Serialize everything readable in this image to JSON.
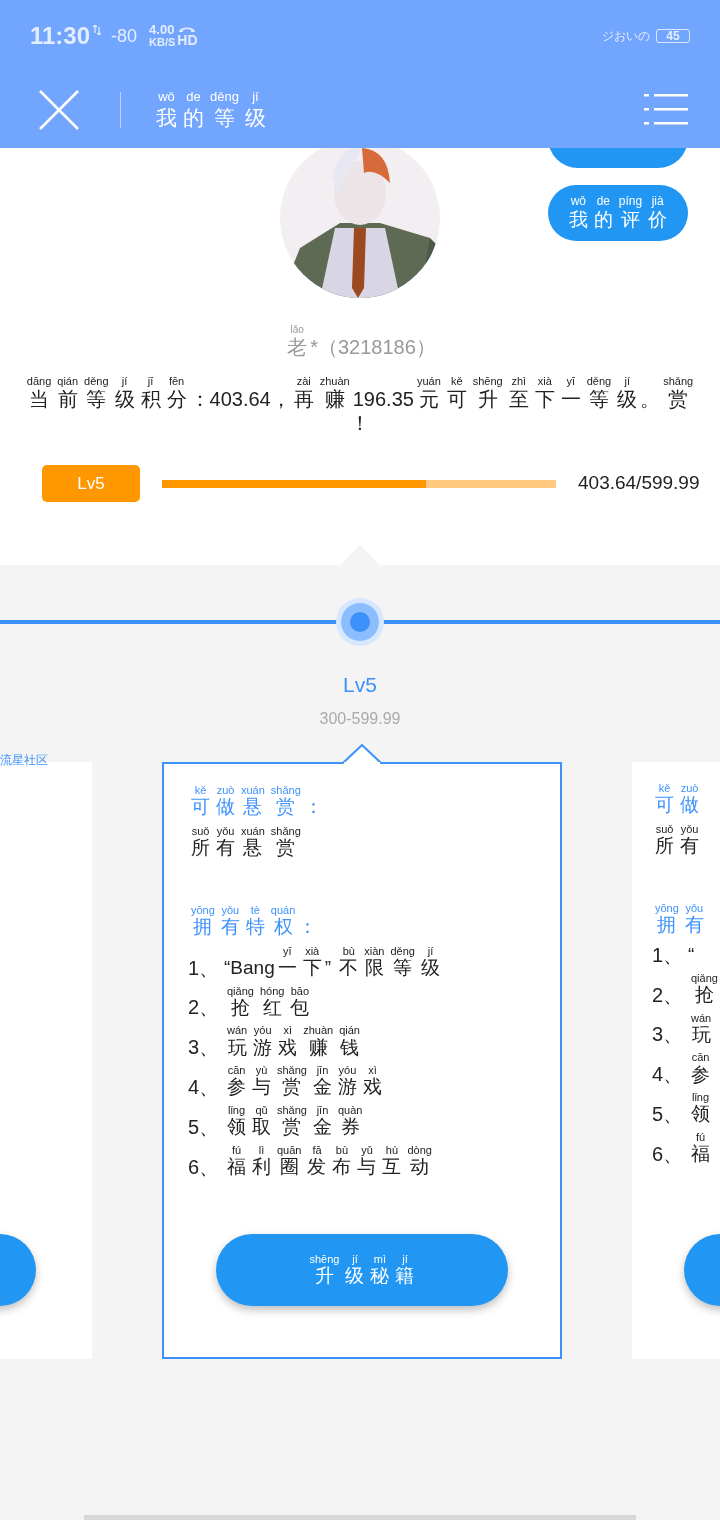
{
  "status_bar": {
    "time": "11:30",
    "signal": "-80",
    "speed": "4.00",
    "speed_unit": "KB/S",
    "hd": "HD",
    "carrier": "ジおいの",
    "battery": "45"
  },
  "header": {
    "title": [
      [
        "wǒ",
        "我"
      ],
      [
        "de",
        "的"
      ],
      [
        "děng",
        "等"
      ],
      [
        "jí",
        "级"
      ]
    ]
  },
  "side_button": {
    "label": [
      [
        "wǒ",
        "我"
      ],
      [
        "de",
        "的"
      ],
      [
        "píng",
        "评"
      ],
      [
        "jià",
        "价"
      ]
    ]
  },
  "profile": {
    "name": [
      [
        "lǎo",
        "老"
      ],
      "*（3218186）"
    ]
  },
  "points_text": [
    [
      "dāng",
      "当"
    ],
    [
      "qián",
      "前"
    ],
    [
      "děng",
      "等"
    ],
    [
      "jí",
      "级"
    ],
    [
      "jī",
      "积"
    ],
    [
      "fēn",
      "分"
    ],
    "：403.64，",
    [
      "zài",
      "再"
    ],
    [
      "zhuàn",
      "赚"
    ],
    "196.35",
    [
      "yuán",
      "元"
    ],
    [
      "kě",
      "可"
    ],
    [
      "shēng",
      "升"
    ],
    [
      "zhì",
      "至"
    ],
    [
      "xià",
      "下"
    ],
    [
      "yī",
      "一"
    ],
    [
      "děng",
      "等"
    ],
    [
      "jí",
      "级"
    ],
    "。",
    [
      "shǎng",
      "赏"
    ],
    "！"
  ],
  "level_bar": {
    "badge": "Lv5",
    "level": 0.67,
    "reading": "403.64/599.99"
  },
  "timeline": {
    "label": "Lv5",
    "range": "300-599.99"
  },
  "left_card": {
    "tag": "流星社区"
  },
  "current_card": {
    "bounty_heading": [
      [
        "kě",
        "可"
      ],
      [
        "zuò",
        "做"
      ],
      [
        "xuán",
        "悬"
      ],
      [
        "shǎng",
        "赏"
      ],
      "："
    ],
    "bounty_text": [
      [
        "suǒ",
        "所"
      ],
      [
        "yǒu",
        "有"
      ],
      [
        "xuán",
        "悬"
      ],
      [
        "shǎng",
        "赏"
      ]
    ],
    "privilege_heading": [
      [
        "yōng",
        "拥"
      ],
      [
        "yǒu",
        "有"
      ],
      [
        "tè",
        "特"
      ],
      [
        "quán",
        "权"
      ],
      "："
    ],
    "privileges": [
      {
        "number": "1、",
        "text": [
          "“Bang",
          [
            "yī",
            "一"
          ],
          [
            "xià",
            "下"
          ],
          "” ",
          [
            "bù",
            "不"
          ],
          [
            "xiàn",
            "限"
          ],
          [
            "děng",
            "等"
          ],
          [
            "jí",
            "级"
          ]
        ]
      },
      {
        "number": "2、",
        "text": [
          [
            "qiǎng",
            "抢"
          ],
          [
            "hóng",
            "红"
          ],
          [
            "bāo",
            "包"
          ]
        ]
      },
      {
        "number": "3、",
        "text": [
          [
            "wán",
            "玩"
          ],
          [
            "yóu",
            "游"
          ],
          [
            "xì",
            "戏"
          ],
          [
            "zhuàn",
            "赚"
          ],
          [
            "qián",
            "钱"
          ]
        ]
      },
      {
        "number": "4、",
        "text": [
          [
            "cān",
            "参"
          ],
          [
            "yù",
            "与"
          ],
          [
            "shǎng",
            "赏"
          ],
          [
            "jīn",
            "金"
          ],
          [
            "yóu",
            "游"
          ],
          [
            "xì",
            "戏"
          ]
        ]
      },
      {
        "number": "5、",
        "text": [
          [
            "lǐng",
            "领"
          ],
          [
            "qǔ",
            "取"
          ],
          [
            "shǎng",
            "赏"
          ],
          [
            "jīn",
            "金"
          ],
          [
            "quàn",
            "券"
          ]
        ]
      },
      {
        "number": "6、",
        "text": [
          [
            "fú",
            "福"
          ],
          [
            "lì",
            "利"
          ],
          [
            "quān",
            "圈"
          ],
          [
            "fā",
            "发"
          ],
          [
            "bù",
            "布"
          ],
          [
            "yǔ",
            "与"
          ],
          [
            "hù",
            "互"
          ],
          [
            "dòng",
            "动"
          ]
        ]
      }
    ],
    "button": [
      [
        "shēng",
        "升"
      ],
      [
        "jí",
        "级"
      ],
      [
        "mì",
        "秘"
      ],
      [
        "jí",
        "籍"
      ]
    ]
  },
  "right_card": {
    "bounty_heading": [
      [
        "kě",
        "可"
      ],
      [
        "zuò",
        "做"
      ]
    ],
    "bounty_text": [
      [
        "suǒ",
        "所"
      ],
      [
        "yǒu",
        "有"
      ]
    ],
    "privilege_heading": [
      [
        "yōng",
        "拥"
      ],
      [
        "yǒu",
        "有"
      ]
    ],
    "privileges": [
      {
        "number": "1、",
        "text": [
          "“"
        ]
      },
      {
        "number": "2、",
        "text": [
          [
            "qiǎng",
            "抢"
          ]
        ]
      },
      {
        "number": "3、",
        "text": [
          [
            "wán",
            "玩"
          ]
        ]
      },
      {
        "number": "4、",
        "text": [
          [
            "cān",
            "参"
          ]
        ]
      },
      {
        "number": "5、",
        "text": [
          [
            "lǐng",
            "领"
          ]
        ]
      },
      {
        "number": "6、",
        "text": [
          [
            "fú",
            "福"
          ]
        ]
      }
    ]
  }
}
